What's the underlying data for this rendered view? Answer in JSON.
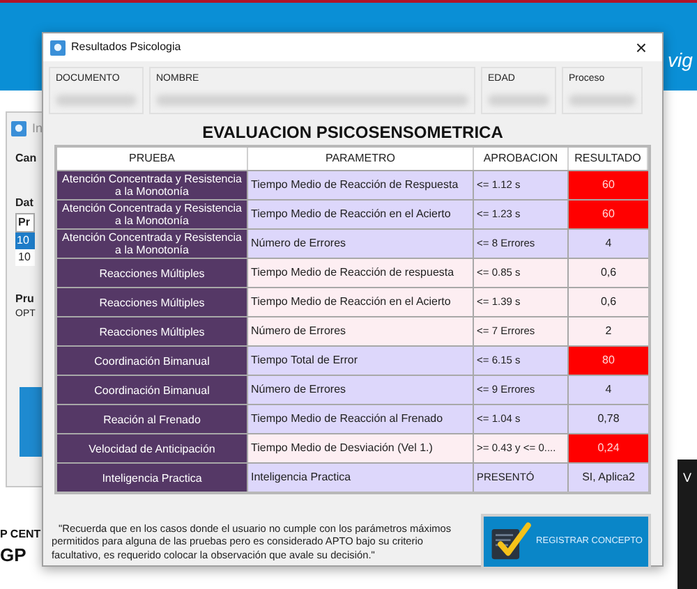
{
  "background": {
    "tagline": "vig",
    "side_letter": "V",
    "back_window": {
      "title": "In",
      "labels": [
        "Can",
        "Dat",
        "Pr",
        "10",
        "10",
        "Pru",
        "OPT"
      ]
    },
    "footer_lines": [
      "P CENT",
      "GP"
    ]
  },
  "window": {
    "title": "Resultados Psicologia",
    "close": "×"
  },
  "header_fields": [
    {
      "label": "DOCUMENTO"
    },
    {
      "label": "NOMBRE"
    },
    {
      "label": "EDAD"
    },
    {
      "label": "Proceso"
    }
  ],
  "heading": "EVALUACION PSICOSENSOMETRICA",
  "table": {
    "columns": [
      "PRUEBA",
      "PARAMETRO",
      "APROBACION",
      "RESULTADO"
    ],
    "rows": [
      {
        "prueba": "Atención Concentrada y Resistencia a la Monotonía",
        "parametro": "Tiempo Medio de Reacción de Respuesta",
        "aprobacion": "<= 1.12 s",
        "resultado": "60",
        "failed": true,
        "color": "#ddd7fb"
      },
      {
        "prueba": "Atención Concentrada y Resistencia a la Monotonía",
        "parametro": "Tiempo Medio de Reacción en el Acierto",
        "aprobacion": "<= 1.23 s",
        "resultado": "60",
        "failed": true,
        "color": "#ddd7fb"
      },
      {
        "prueba": "Atención Concentrada y Resistencia a la Monotonía",
        "parametro": "Número de Errores",
        "aprobacion": "<= 8 Errores",
        "resultado": "4",
        "failed": false,
        "color": "#ddd7fb"
      },
      {
        "prueba": "Reacciones Múltiples",
        "parametro": "Tiempo Medio de Reacción de respuesta",
        "aprobacion": "<= 0.85 s",
        "resultado": "0,6",
        "failed": false,
        "color": "#fdeef2"
      },
      {
        "prueba": "Reacciones Múltiples",
        "parametro": "Tiempo Medio de Reacción en el Acierto",
        "aprobacion": "<= 1.39 s",
        "resultado": "0,6",
        "failed": false,
        "color": "#fdeef2"
      },
      {
        "prueba": "Reacciones Múltiples",
        "parametro": "Número de Errores",
        "aprobacion": "<= 7 Errores",
        "resultado": "2",
        "failed": false,
        "color": "#fdeef2"
      },
      {
        "prueba": "Coordinación Bimanual",
        "parametro": "Tiempo Total de Error",
        "aprobacion": "<= 6.15 s",
        "resultado": "80",
        "failed": true,
        "color": "#ddd7fb"
      },
      {
        "prueba": "Coordinación Bimanual",
        "parametro": "Número de Errores",
        "aprobacion": "<= 9 Errores",
        "resultado": "4",
        "failed": false,
        "color": "#ddd7fb"
      },
      {
        "prueba": "Reación al Frenado",
        "parametro": "Tiempo Medio de Reacción al Frenado",
        "aprobacion": "<= 1.04 s",
        "resultado": "0,78",
        "failed": false,
        "color": "#ddd7fb"
      },
      {
        "prueba": "Velocidad de Anticipación",
        "parametro": "Tiempo Medio de Desviación (Vel 1.)",
        "aprobacion": ">= 0.43 y <= 0....",
        "resultado": "0,24",
        "failed": true,
        "color": "#fdeef2"
      },
      {
        "prueba": "Inteligencia Practica",
        "parametro": "Inteligencia Practica",
        "aprobacion": "PRESENTÓ",
        "resultado": "SI, Aplica2",
        "failed": false,
        "color": "#ddd7fb"
      }
    ]
  },
  "note": "\"Recuerda que en los casos donde el usuario no cumple con los parámetros máximos permitidos para alguna de las pruebas pero es considerado APTO bajo su criterio facultativo, es requerido colocar la observación que avale su decisión.\"",
  "register_button": "REGISTRAR CONCEPTO"
}
